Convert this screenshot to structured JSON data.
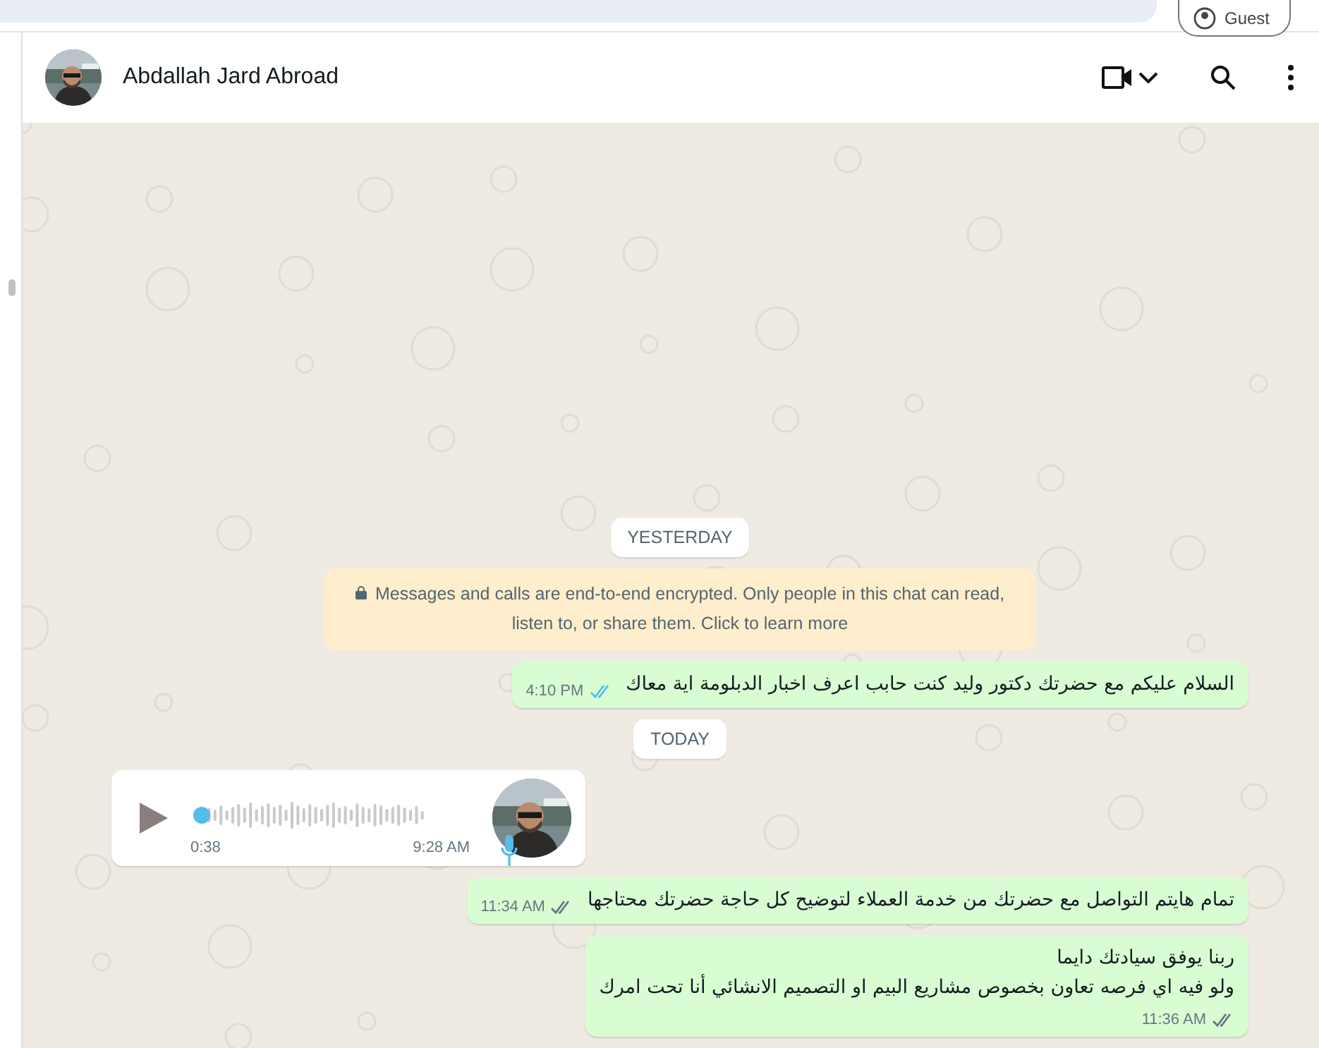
{
  "browser": {
    "profile_button": "Guest"
  },
  "chat_header": {
    "name": "Abdallah Jard Abroad"
  },
  "messages": [
    {
      "kind": "date",
      "text": "YESTERDAY"
    },
    {
      "kind": "system",
      "text": "Messages and calls are end-to-end encrypted. Only people in this chat can read, listen to, or share them. Click to learn more"
    },
    {
      "kind": "outgoing",
      "lines": [
        "السلام عليكم مع حضرتك دكتور وليد كنت حابب اعرف اخبار الدبلومة اية معاك"
      ],
      "time": "4:10 PM",
      "read": true
    },
    {
      "kind": "date",
      "text": "TODAY"
    },
    {
      "kind": "voice",
      "duration": "0:38",
      "time": "9:28 AM",
      "level": 0
    },
    {
      "kind": "outgoing",
      "lines": [
        "تمام هايتم التواصل مع حضرتك من خدمة العملاء لتوضيح كل حاجة حضرتك محتاجها"
      ],
      "time": "11:34 AM",
      "read": false
    },
    {
      "kind": "outgoing",
      "lines": [
        "ربنا يوفق سيادتك دايما",
        "ولو فيه اي فرصه تعاون بخصوص مشاريع البيم او التصميم الانشائي أنا تحت امرك"
      ],
      "time": "11:36 AM",
      "read": false
    }
  ]
}
